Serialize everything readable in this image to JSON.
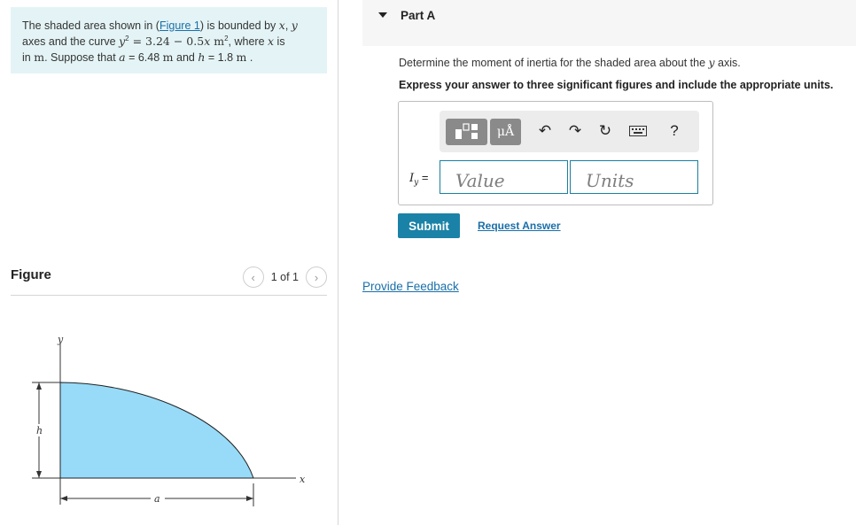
{
  "problem": {
    "t1": "The shaded area shown in (",
    "figure_link": "Figure 1",
    "t2": ") is bounded by ",
    "var_x": "x",
    "comma": ", ",
    "var_y": "y",
    "t3": "axes and the curve ",
    "eq_y": "y",
    "eq_sq": "2",
    "eq_rest": " = 3.24 − 0.5",
    "eq_x": "x",
    "eq_unit": " m",
    "eq_unit_sq": "2",
    "t4": ", where ",
    "var_x2": "x",
    "t5": " is",
    "t6": "in ",
    "unit_m": "m",
    "t7": ". Suppose that ",
    "var_a": "a",
    "t8": " = 6.48 ",
    "unit_m2": " m",
    "t9": " and ",
    "var_h": "h",
    "t10": " = 1.8 ",
    "unit_m3": " m",
    "t11": " ."
  },
  "figure": {
    "title": "Figure",
    "pager": "1 of 1",
    "prev_icon": "‹",
    "next_icon": "›",
    "label_y": "y",
    "label_x": "x",
    "label_h": "h",
    "label_a": "a",
    "fill_color": "#97dbf8"
  },
  "part": {
    "title": "Part A",
    "question_pre": "Determine the moment of inertia for the shaded area about the ",
    "question_var": "y",
    "question_post": " axis.",
    "instruction": "Express your answer to three significant figures and include the appropriate units."
  },
  "toolbar": {
    "units_label": "μÅ",
    "undo_icon": "↶",
    "redo_icon": "↷",
    "reset_icon": "↻",
    "help_label": "?"
  },
  "answer": {
    "label_var": "I",
    "label_sub": "y",
    "label_eq": " =",
    "value_placeholder": "Value",
    "units_placeholder": "Units"
  },
  "actions": {
    "submit": "Submit",
    "request": "Request Answer",
    "feedback": "Provide Feedback"
  },
  "colors": {
    "accent": "#1a82a6",
    "link": "#1a6fa8",
    "problem_bg": "#e4f4f6"
  }
}
